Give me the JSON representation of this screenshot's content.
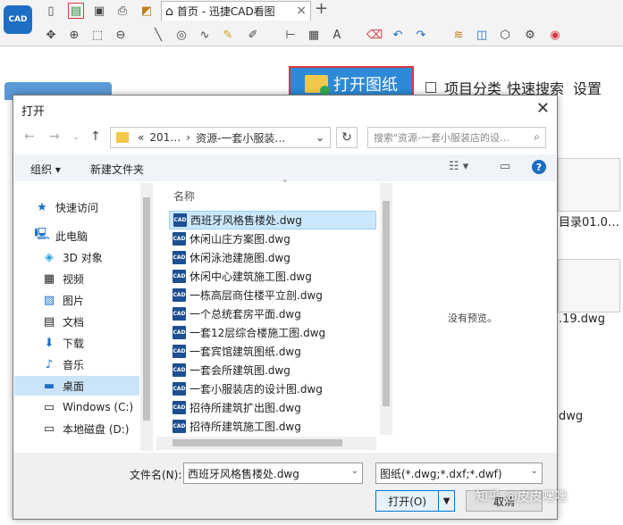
{
  "app": {
    "logo_text": "CAD",
    "tab_title": "首页 - 迅捷CAD看图",
    "open_button": "打开图纸",
    "project_category": "项目分类",
    "quick_search": "快速搜索",
    "settings": "设置",
    "bg_labels": [
      "目录01.0…",
      ".19.dwg",
      "dwg"
    ]
  },
  "dialog": {
    "title": "打开",
    "address": [
      "«",
      "201…",
      "›",
      "资源-一套小服装…",
      "⌄"
    ],
    "search_placeholder": "搜索\"资源-一套小服装店的设…",
    "organize": "组织 ▾",
    "new_folder": "新建文件夹",
    "column_name": "名称",
    "nav": [
      {
        "label": "快速访问",
        "icon": "star-icon"
      },
      {
        "label": "此电脑",
        "icon": "computer-icon"
      },
      {
        "label": "3D 对象",
        "icon": "cube-icon"
      },
      {
        "label": "视频",
        "icon": "video-icon"
      },
      {
        "label": "图片",
        "icon": "picture-icon"
      },
      {
        "label": "文档",
        "icon": "document-icon"
      },
      {
        "label": "下载",
        "icon": "download-icon"
      },
      {
        "label": "音乐",
        "icon": "music-icon"
      },
      {
        "label": "桌面",
        "icon": "desktop-icon"
      },
      {
        "label": "Windows (C:)",
        "icon": "drive-icon"
      },
      {
        "label": "本地磁盘 (D:)",
        "icon": "drive-icon"
      }
    ],
    "files": [
      "西班牙风格售楼处.dwg",
      "休闲山庄方案图.dwg",
      "休闲泳池建施图.dwg",
      "休闲中心建筑施工图.dwg",
      "一栋高层商住楼平立剖.dwg",
      "一个总统套房平面.dwg",
      "一套12层综合楼施工图.dwg",
      "一套宾馆建筑图纸.dwg",
      "一套会所建筑图.dwg",
      "一套小服装店的设计图.dwg",
      "招待所建筑扩出图.dwg",
      "招待所建筑施工图.dwg"
    ],
    "file_icon_text": "CAD",
    "no_preview": "没有预览。",
    "filename_label": "文件名(N):",
    "filename_value": "西班牙风格售楼处.dwg",
    "filter_value": "图纸(*.dwg;*.dxf;*.dwf)",
    "open_label": "打开(O)",
    "cancel_label": "取消"
  },
  "watermark": "知乎 @皮皮嘿嘿"
}
